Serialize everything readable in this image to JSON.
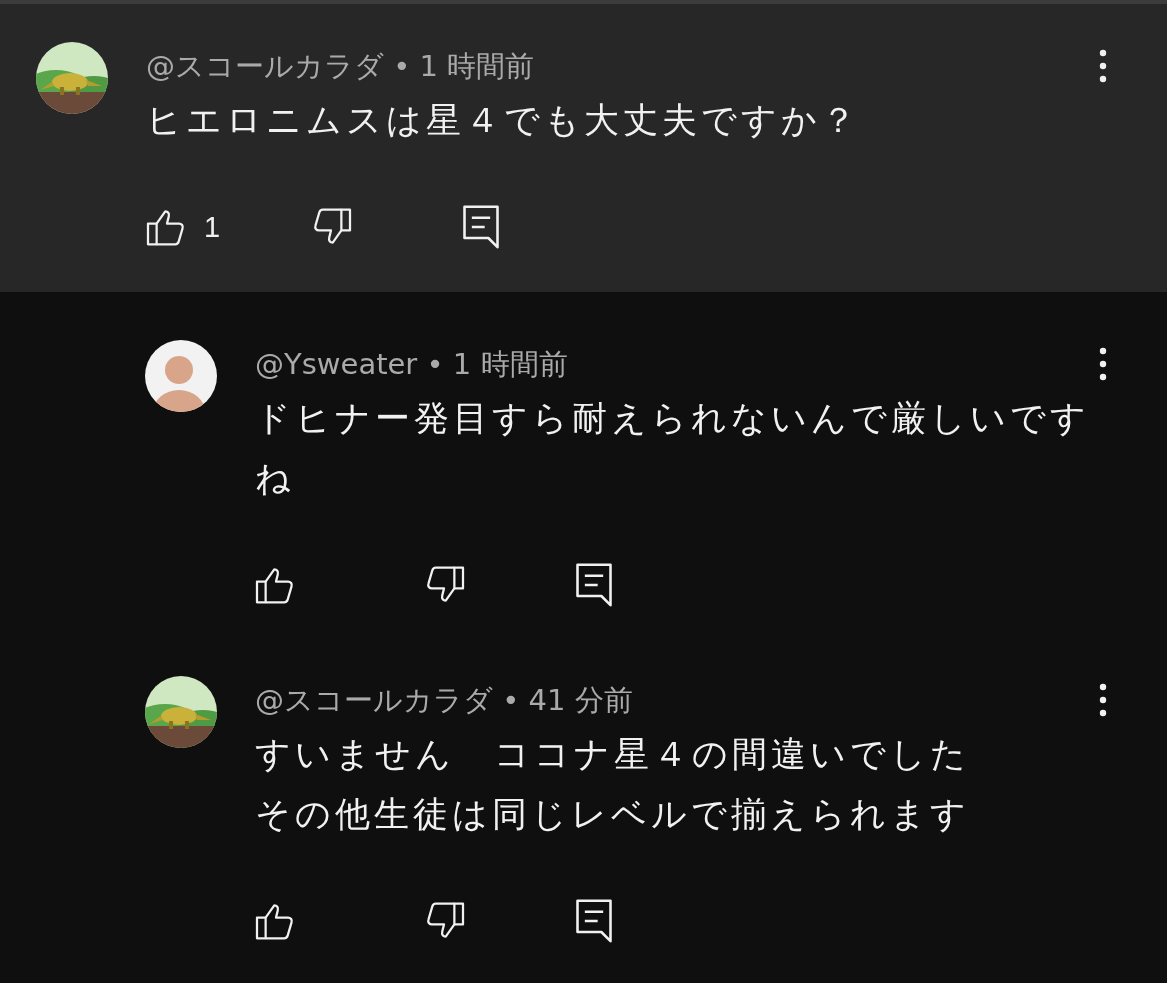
{
  "comments": [
    {
      "kind": "animal",
      "meta": "@スコールカラダ • 1 時間前",
      "lines": [
        "ヒエロニムスは星４でも大丈夫ですか？"
      ],
      "likes": "1",
      "highlighted": true,
      "reply": false
    },
    {
      "kind": "person",
      "meta": "@Ysweater • 1 時間前",
      "lines": [
        "ドヒナー発目すら耐えられないんで厳しいですね"
      ],
      "highlighted": false,
      "reply": true
    },
    {
      "kind": "animal",
      "meta": "@スコールカラダ • 41 分前",
      "lines": [
        "すいません　ココナ星４の間違いでした",
        "その他生徒は同じレベルで揃えられます"
      ],
      "highlighted": false,
      "reply": true
    }
  ]
}
